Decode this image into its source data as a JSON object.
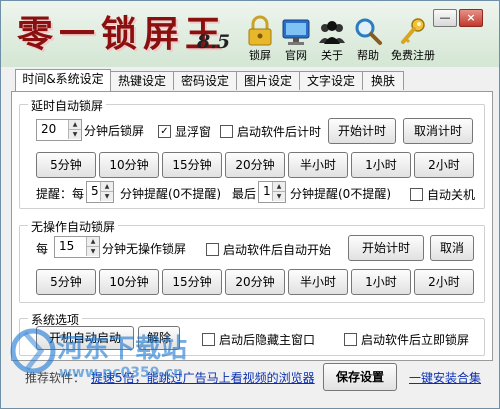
{
  "app": {
    "title": "零一锁屏王",
    "version": "8.5"
  },
  "toolbar": [
    {
      "label": "锁屏",
      "icon": "padlock-icon"
    },
    {
      "label": "官网",
      "icon": "monitor-icon"
    },
    {
      "label": "关于",
      "icon": "people-icon"
    },
    {
      "label": "帮助",
      "icon": "magnifier-icon"
    },
    {
      "label": "免费注册",
      "icon": "key-icon"
    }
  ],
  "window_controls": {
    "minimize": "—",
    "close": "×"
  },
  "tabs": [
    "时间&系统设定",
    "热键设定",
    "密码设定",
    "图片设定",
    "文字设定",
    "换肤"
  ],
  "delay_lock": {
    "title": "延时自动锁屏",
    "minutes_value": "20",
    "minutes_suffix": "分钟后锁屏",
    "show_float_window": {
      "label": "显浮窗",
      "checked": true
    },
    "timer_on_startup": {
      "label": "启动软件后计时",
      "checked": false
    },
    "start_button": "开始计时",
    "cancel_button": "取消计时",
    "presets": [
      "5分钟",
      "10分钟",
      "15分钟",
      "20分钟",
      "半小时",
      "1小时",
      "2小时"
    ],
    "remind_prefix": "提醒：每",
    "remind_every_value": "5",
    "remind_every_suffix": "分钟提醒(0不提醒)",
    "last_prefix": "最后",
    "last_value": "1",
    "last_suffix": "分钟提醒(0不提醒)",
    "auto_shutdown": {
      "label": "自动关机",
      "checked": false
    }
  },
  "idle_lock": {
    "title": "无操作自动锁屏",
    "prefix": "每",
    "minutes_value": "15",
    "minutes_suffix": "分钟无操作锁屏",
    "auto_start": {
      "label": "启动软件后自动开始",
      "checked": false
    },
    "start_button": "开始计时",
    "cancel_button": "取消",
    "presets": [
      "5分钟",
      "10分钟",
      "15分钟",
      "20分钟",
      "半小时",
      "1小时",
      "2小时"
    ]
  },
  "system": {
    "title": "系统选项",
    "boot_start_button": "开机自动启动",
    "remove_button": "解除",
    "hide_main": {
      "label": "启动后隐藏主窗口",
      "checked": false
    },
    "lock_on_startup": {
      "label": "启动软件后立即锁屏",
      "checked": false
    }
  },
  "footer": {
    "ad_label": "推荐软件：",
    "ad_link": "提速5倍，能跳过广告马上看视频的浏览器",
    "save_button": "保存设置",
    "install_link": "一键安装合集"
  },
  "watermark": {
    "name": "河东下载站",
    "url": "www.pc0359.cn"
  },
  "colors": {
    "title_red": "#8a1010",
    "link_blue": "#0b2fb0",
    "watermark_blue": "#1f78d1",
    "close_red": "#c0392b"
  }
}
